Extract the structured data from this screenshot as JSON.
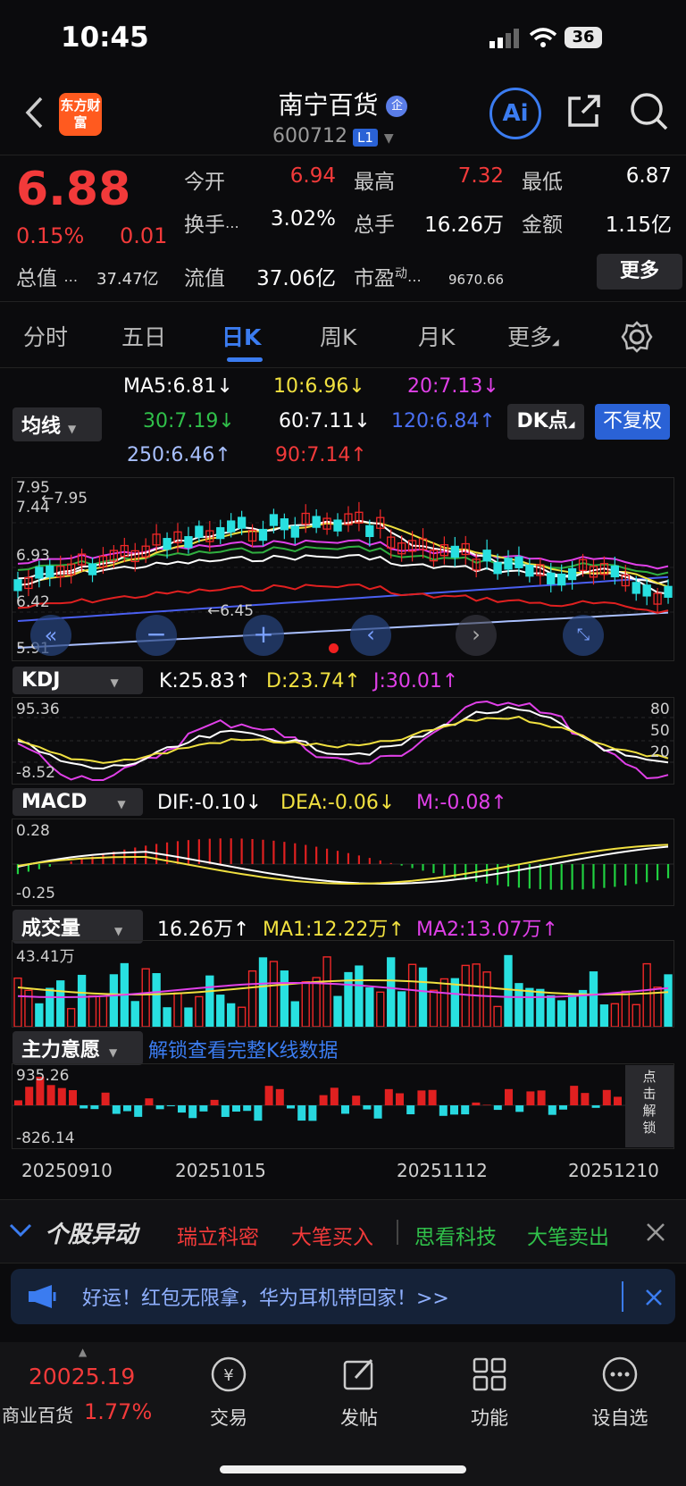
{
  "status": {
    "time": "10:45",
    "battery": "36"
  },
  "header": {
    "logo": "东方财富",
    "name": "南宁百货",
    "name_badge": "企",
    "code": "600712",
    "level": "L1",
    "ai": "Ai"
  },
  "quote": {
    "price": "6.88",
    "change_pct": "0.15%",
    "change_amt": "0.01",
    "open_label": "今开",
    "open": "6.94",
    "high_label": "最高",
    "high": "7.32",
    "low_label": "最低",
    "low": "6.87",
    "turnover_label": "换手",
    "turnover": "3.02%",
    "volume_label": "总手",
    "volume": "16.26万",
    "amount_label": "金额",
    "amount": "1.15亿",
    "mktcap_label": "总值",
    "mktcap": "37.47亿",
    "float_label": "流值",
    "float": "37.06亿",
    "pe_label": "市盈",
    "pe_sup": "动",
    "pe": "9670.66",
    "more": "更多"
  },
  "tabs": [
    "分时",
    "五日",
    "日K",
    "周K",
    "月K",
    "更多"
  ],
  "active_tab": "日K",
  "ma": {
    "selector": "均线",
    "ma5": "MA5:6.81",
    "ma10": "10:6.96",
    "ma20": "20:7.13",
    "ma30": "30:7.19",
    "ma60": "60:7.11",
    "ma120": "120:6.84",
    "ma250": "250:6.46",
    "ma90": "90:7.14",
    "dk": "DK点",
    "adjust": "不复权"
  },
  "kline": {
    "y_high": "7.95",
    "y_mid": "6.93",
    "y_low2": "6.42",
    "y_low": "5.91",
    "max_mark": "←7.95",
    "min_mark": "←6.45",
    "top_small": "7.44"
  },
  "kdj": {
    "selector": "KDJ",
    "k": "K:25.83",
    "d": "D:23.74",
    "j": "J:30.01",
    "y_top": "95.36",
    "y_bot": "-8.52",
    "r80": "80",
    "r50": "50",
    "r20": "20"
  },
  "macd": {
    "selector": "MACD",
    "dif": "DIF:-0.10",
    "dea": "DEA:-0.06",
    "m": "M:-0.08",
    "y_top": "0.28",
    "y_bot": "-0.25"
  },
  "vol": {
    "selector": "成交量",
    "v": "16.26万",
    "ma1": "MA1:12.22万",
    "ma2": "MA2:13.07万",
    "y_top": "43.41万"
  },
  "main": {
    "selector": "主力意愿",
    "unlock": "解锁查看完整K线数据",
    "y_top": "935.26",
    "y_bot": "-826.14",
    "side": "点击解锁"
  },
  "dates": [
    "20250910",
    "20251015",
    "20251112",
    "20251210"
  ],
  "ticker": {
    "title": "个股异动",
    "items": [
      {
        "name": "瑞立科密",
        "tag": "大笔买入"
      },
      {
        "name": "思看科技",
        "tag": "大笔卖出"
      }
    ]
  },
  "banner": {
    "text": "好运！红包无限拿，华为耳机带回家！>>"
  },
  "bottom": {
    "index_value": "20025.19",
    "index_name": "商业百货",
    "index_pct": "1.77%",
    "items": [
      "交易",
      "发帖",
      "功能",
      "设自选"
    ]
  }
}
